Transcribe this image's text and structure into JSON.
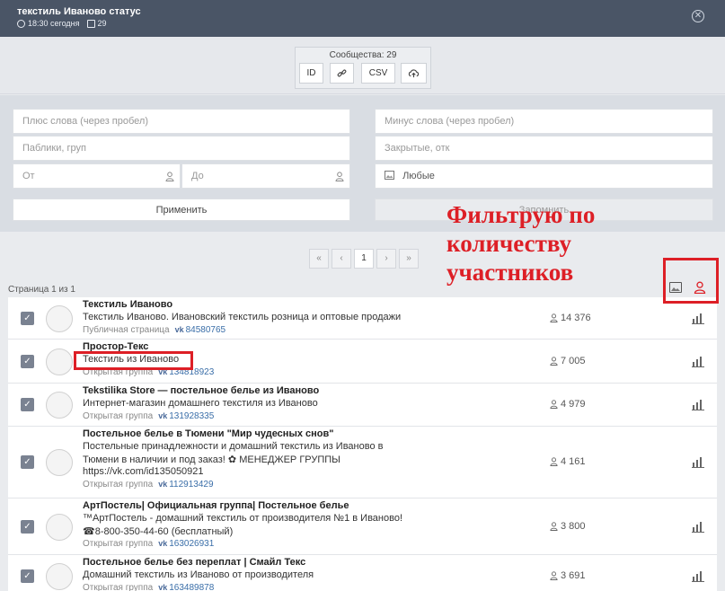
{
  "header": {
    "title": "текстиль Иваново статус",
    "time": "18:30 сегодня",
    "count": "29"
  },
  "export": {
    "label": "Сообщества: 29",
    "id_label": "ID",
    "csv_label": "CSV"
  },
  "filters": {
    "plus_words_placeholder": "Плюс слова (через пробел)",
    "minus_words_placeholder": "Минус слова (через пробел)",
    "publics_placeholder": "Паблики, груп",
    "closed_placeholder": "Закрытые, отк",
    "from_placeholder": "От",
    "to_placeholder": "До",
    "image_filter_value": "Любые",
    "apply_label": "Применить",
    "save_label": "Запомнить"
  },
  "pager": {
    "first": "«",
    "prev": "‹",
    "current": "1",
    "next": "›",
    "last": "»"
  },
  "page_info": "Страница 1 из 1",
  "annotation": {
    "line1": "Фильтрую по",
    "line2": "количеству",
    "line3": "участников"
  },
  "communities": [
    {
      "name": "Текстиль Иваново",
      "desc": [
        "Текстиль Иваново. Ивановский текстиль розница и оптовые продажи"
      ],
      "type": "Публичная страница",
      "vk_id": "84580765",
      "members": "14 376"
    },
    {
      "name": "Простор-Текс",
      "desc": [
        "Текстиль из Иваново"
      ],
      "type": "Открытая группа",
      "vk_id": "134818923",
      "members": "7 005"
    },
    {
      "name": "Tekstilika Store — постельное белье из Иваново",
      "desc": [
        "Интернет-магазин домашнего текстиля из Иваново 󠀠"
      ],
      "type": "Открытая группа",
      "vk_id": "131928335",
      "members": "4 979"
    },
    {
      "name": "Постельное белье в Тюмени \"Мир чудесных снов\"",
      "desc": [
        "Постельные принадлежности и домашний текстиль из Иваново в",
        "Тюмени в наличии и под заказ! ✿ МЕНЕДЖЕР ГРУППЫ",
        "https://vk.com/id135050921"
      ],
      "type": "Открытая группа",
      "vk_id": "112913429",
      "members": "4 161"
    },
    {
      "name": "АртПостель| Официальная группа| Постельное белье",
      "desc": [
        "™АртПостель - домашний текстиль от производителя №1 в Иваново!",
        "☎8-800-350-44-60 (бесплатный)"
      ],
      "type": "Открытая группа",
      "vk_id": "163026931",
      "members": "3 800"
    },
    {
      "name": "Постельное белье без переплат | Смайл Текс",
      "desc": [
        "Домашний текстиль из Иваново от производителя"
      ],
      "type": "Открытая группа",
      "vk_id": "163489878",
      "members": "3 691"
    }
  ],
  "colors": {
    "header_bg": "#4a5566",
    "annotation_red": "#dd1f26",
    "link_blue": "#3a6ea8"
  }
}
